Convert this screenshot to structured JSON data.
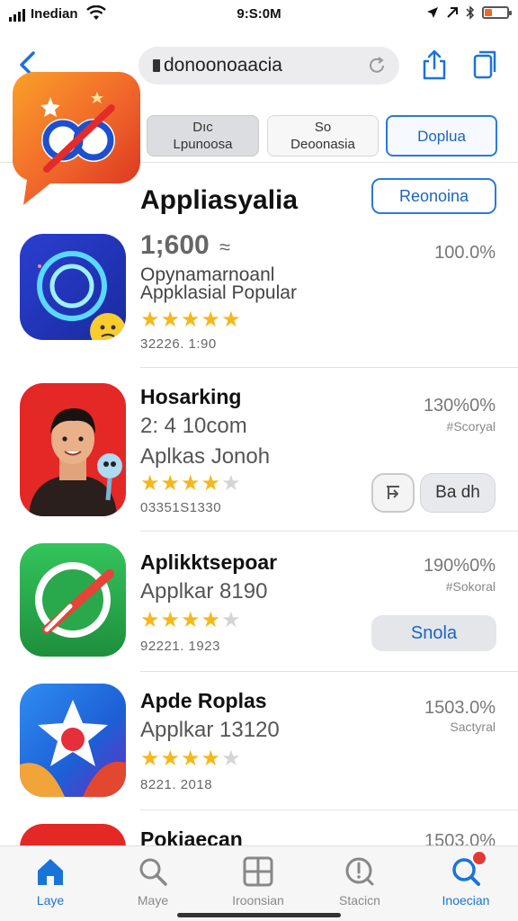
{
  "status_bar": {
    "carrier": "Inedian",
    "time": "9:S:0M",
    "battery_level": 0.35
  },
  "nav": {
    "search_text": "donoonoaacia"
  },
  "segments": [
    {
      "line1": "Dıc",
      "line2": "Lpunoosa"
    },
    {
      "line1": "So",
      "line2": "Deoonasia"
    },
    {
      "line1": "Doplua",
      "line2": ""
    }
  ],
  "section": {
    "title": "Appliasyalia",
    "action_label": "Reonoina"
  },
  "apps": [
    {
      "title": "1;600",
      "title_suffix": "≈",
      "line2": "Opynamarnoanl",
      "line3": "Appklasial Popular",
      "rating": 4.5,
      "meta": "32226. 1:90",
      "pct": "100.0%",
      "sub": ""
    },
    {
      "title": "Hosarking",
      "line2": "2: 4 10com",
      "line3": "Aplkas Jonoh",
      "rating": 4,
      "meta": "03351S1330",
      "pct": "130%0%",
      "sub": "#Scoryal",
      "button_label": "Ba dh"
    },
    {
      "title": "Aplikktsepoar",
      "line2": "Applkar 8190",
      "rating": 4,
      "meta": "92221. 1923",
      "pct": "190%0%",
      "sub": "#Sokoral",
      "button_label": "Snola"
    },
    {
      "title": "Apde Roplas",
      "line2": "Applkar 13120",
      "rating": 4,
      "meta": "8221. 2018",
      "pct": "1503.0%",
      "sub": "Sactyral"
    },
    {
      "title": "Pokiaecan",
      "pct": "1503.0%"
    }
  ],
  "tabbar": [
    {
      "label": "Laye",
      "icon": "home-icon",
      "active": true
    },
    {
      "label": "Maye",
      "icon": "search-icon",
      "active": false
    },
    {
      "label": "Iroonsian",
      "icon": "grid-icon",
      "active": false
    },
    {
      "label": "Stacicn",
      "icon": "alert-icon",
      "active": false
    },
    {
      "label": "Inoecian",
      "icon": "notification-icon",
      "active": true
    }
  ],
  "colors": {
    "accent": "#1a73d9",
    "star": "#f5b81a",
    "badge": "#e53935"
  }
}
